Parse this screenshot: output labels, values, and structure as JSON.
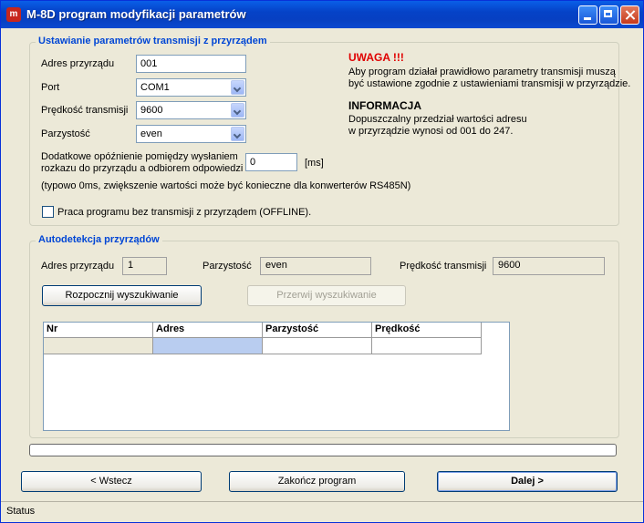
{
  "window": {
    "title": "M-8D program modyfikacji parametrów",
    "icon_text": "m"
  },
  "transmission": {
    "group_title": "Ustawianie parametrów transmisji z przyrządem",
    "address_label": "Adres przyrządu",
    "address_value": "001",
    "port_label": "Port",
    "port_value": "COM1",
    "speed_label": "Prędkość transmisji",
    "speed_value": "9600",
    "parity_label": "Parzystość",
    "parity_value": "even",
    "delay_label_line1": "Dodatkowe opóźnienie pomiędzy wysłaniem",
    "delay_label_line2": "rozkazu do przyrządu a odbiorem odpowiedzi",
    "delay_value": "0",
    "delay_unit": "[ms]",
    "delay_hint": "(typowo 0ms, zwiększenie wartości może być konieczne dla konwerterów RS485N)",
    "offline_label": "Praca programu bez transmisji z przyrządem (OFFLINE)."
  },
  "warning": {
    "title": "UWAGA !!!",
    "line1": "Aby program działał prawidłowo parametry transmisji muszą",
    "line2": "być ustawione zgodnie z ustawieniami transmisji w przyrządzie."
  },
  "info": {
    "title": "INFORMACJA",
    "line1": "Dopuszczalny przedział wartości adresu",
    "line2": "w przyrządzie wynosi od 001 do 247."
  },
  "autodetect": {
    "group_title": "Autodetekcja przyrządów",
    "address_label": "Adres przyrządu",
    "address_value": "1",
    "parity_label": "Parzystość",
    "parity_value": "even",
    "speed_label": "Prędkość transmisji",
    "speed_value": "9600",
    "start_button": "Rozpocznij wyszukiwanie",
    "stop_button": "Przerwij wyszukiwanie",
    "columns": [
      "Nr",
      "Adres",
      "Parzystość",
      "Prędkość"
    ]
  },
  "footer": {
    "back_button": "< Wstecz",
    "exit_button": "Zakończ program",
    "next_button": "Dalej >"
  },
  "status": {
    "text": "Status"
  }
}
